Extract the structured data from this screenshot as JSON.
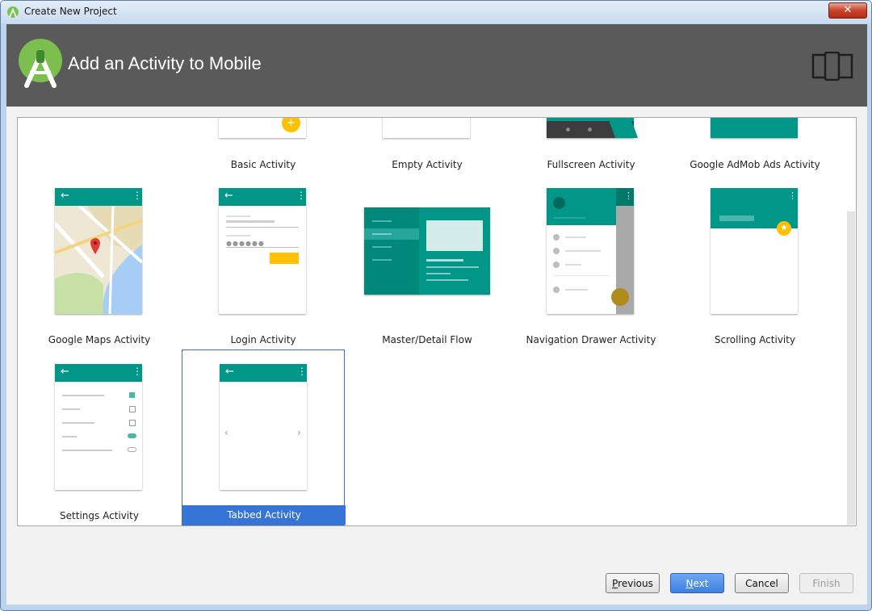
{
  "window": {
    "title": "Create New Project",
    "close_label": "✕"
  },
  "header": {
    "title": "Add an Activity to Mobile"
  },
  "gallery": {
    "items": [
      {
        "label": "Basic Activity"
      },
      {
        "label": "Empty Activity"
      },
      {
        "label": "Fullscreen Activity"
      },
      {
        "label": "Google AdMob Ads Activity"
      },
      {
        "label": "Google Maps Activity"
      },
      {
        "label": "Login Activity"
      },
      {
        "label": "Master/Detail Flow"
      },
      {
        "label": "Navigation Drawer Activity"
      },
      {
        "label": "Scrolling Activity"
      },
      {
        "label": "Settings Activity"
      },
      {
        "label": "Tabbed Activity",
        "selected": true
      }
    ]
  },
  "buttons": {
    "previous": {
      "mnemonic": "P",
      "rest": "revious"
    },
    "next": {
      "mnemonic": "N",
      "rest": "ext"
    },
    "cancel": "Cancel",
    "finish": "Finish"
  },
  "colors": {
    "accent": "#009688",
    "header": "#5a5a5a",
    "selection": "#3675d6",
    "fab": "#ffc107"
  }
}
